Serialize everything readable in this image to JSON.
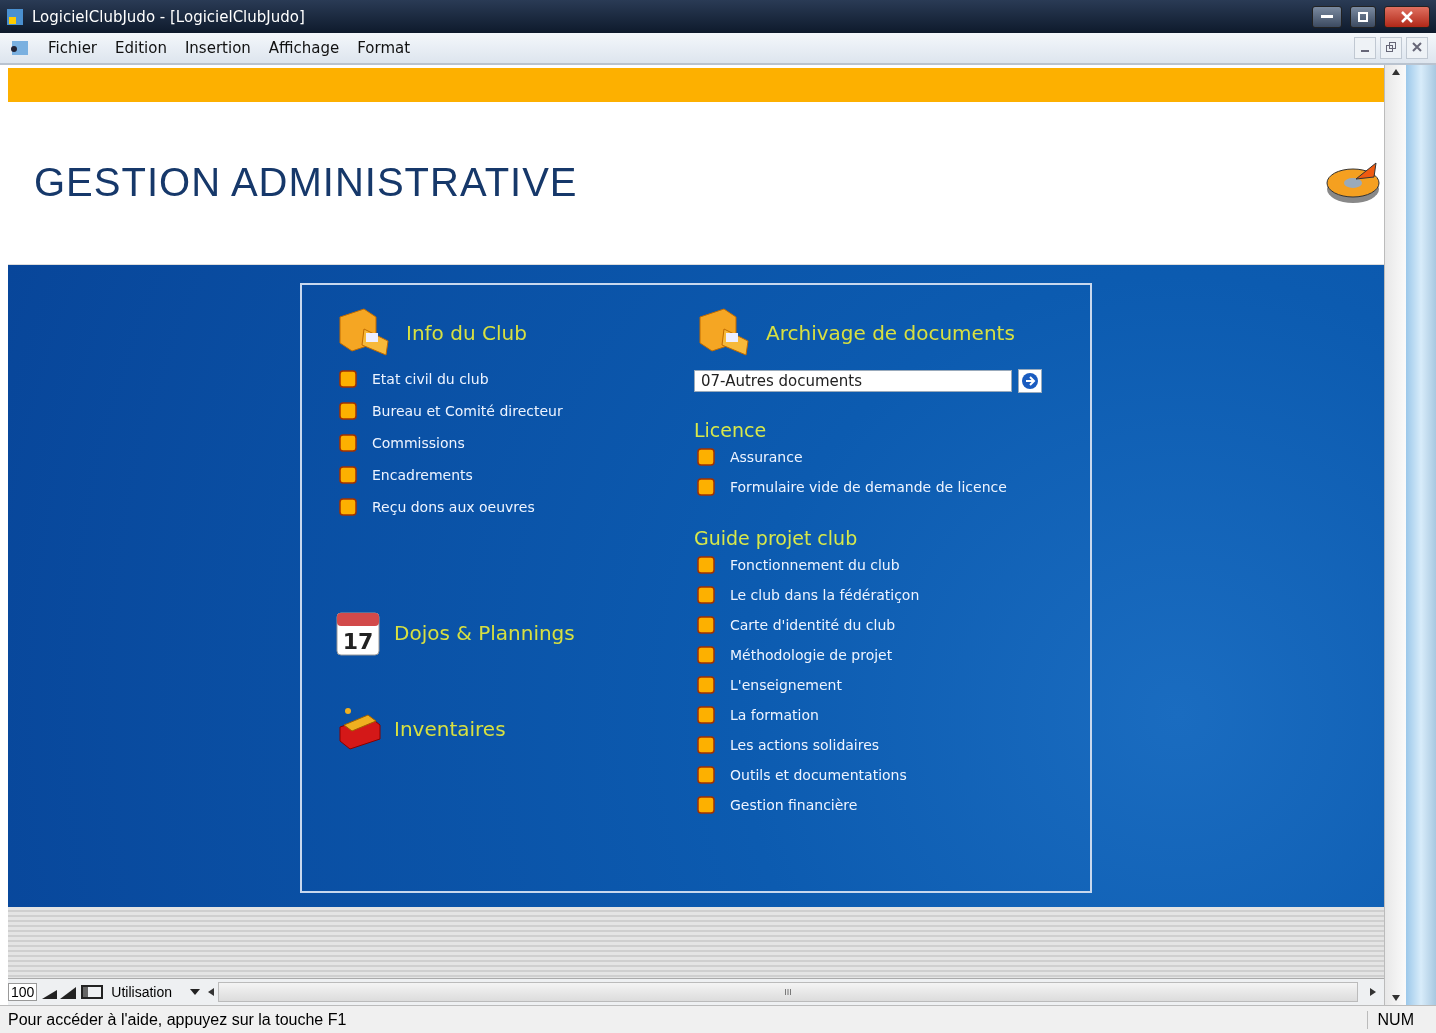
{
  "window": {
    "title": "LogicielClubJudo - [LogicielClubJudo]"
  },
  "menu": [
    "Fichier",
    "Edition",
    "Insertion",
    "Affichage",
    "Format"
  ],
  "header": {
    "title": "GESTION ADMINISTRATIVE"
  },
  "left_sections": [
    {
      "kind": "folder",
      "title": "Info du Club",
      "items": [
        "Etat civil du club",
        "Bureau et Comité directeur",
        "Commissions",
        "Encadrements",
        "Reçu dons aux oeuvres"
      ]
    },
    {
      "kind": "calendar",
      "title": "Dojos & Plannings",
      "calendar_day": "17"
    },
    {
      "kind": "toolbox",
      "title": "Inventaires"
    }
  ],
  "archive": {
    "title": "Archivage de documents",
    "value": "07-Autres documents"
  },
  "groups": [
    {
      "title": "Licence",
      "items": [
        "Assurance",
        "Formulaire vide de demande de licence"
      ]
    },
    {
      "title": "Guide projet club",
      "items": [
        "Fonctionnement du club",
        "Le club dans la fédératiçon",
        "Carte d'identité du club",
        "Méthodologie de projet",
        "L'enseignement",
        "La formation",
        "Les actions solidaires",
        "Outils et documentations",
        "Gestion financière"
      ]
    }
  ],
  "toolbar": {
    "zoom": "100",
    "view": "Utilisation",
    "scroll_mark": "III"
  },
  "status_bar": {
    "message": "Pour accéder à l'aide, appuyez sur la touche F1",
    "indicator": "NUM"
  }
}
